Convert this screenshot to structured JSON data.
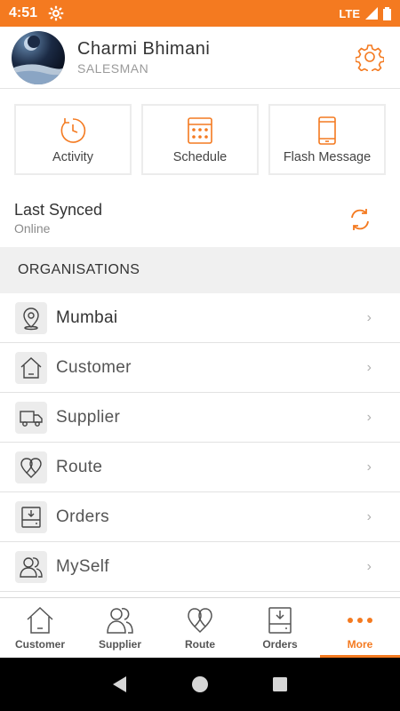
{
  "status_bar": {
    "time": "4:51",
    "network": "LTE"
  },
  "profile": {
    "name": "Charmi Bhimani",
    "role": "SALESMAN"
  },
  "quick_actions": [
    {
      "label": "Activity",
      "icon": "activity-icon"
    },
    {
      "label": "Schedule",
      "icon": "calendar-icon"
    },
    {
      "label": "Flash Message",
      "icon": "phone-icon"
    }
  ],
  "sync": {
    "title": "Last Synced",
    "status": "Online"
  },
  "section_title": "ORGANISATIONS",
  "menu": [
    {
      "label": "Mumbai",
      "icon": "location-pin-icon"
    },
    {
      "label": "Customer",
      "icon": "home-icon"
    },
    {
      "label": "Supplier",
      "icon": "truck-icon"
    },
    {
      "label": "Route",
      "icon": "route-icon"
    },
    {
      "label": "Orders",
      "icon": "inbox-icon"
    },
    {
      "label": "MySelf",
      "icon": "users-icon"
    }
  ],
  "bottom_nav": [
    {
      "label": "Customer",
      "icon": "home-icon",
      "active": false
    },
    {
      "label": "Supplier",
      "icon": "users-icon",
      "active": false
    },
    {
      "label": "Route",
      "icon": "route-icon",
      "active": false
    },
    {
      "label": "Orders",
      "icon": "inbox-icon",
      "active": false
    },
    {
      "label": "More",
      "icon": "more-dots-icon",
      "active": true
    }
  ],
  "colors": {
    "accent": "#f47a20",
    "divider": "#e2e2e2",
    "section_bg": "#f0f0f0"
  }
}
